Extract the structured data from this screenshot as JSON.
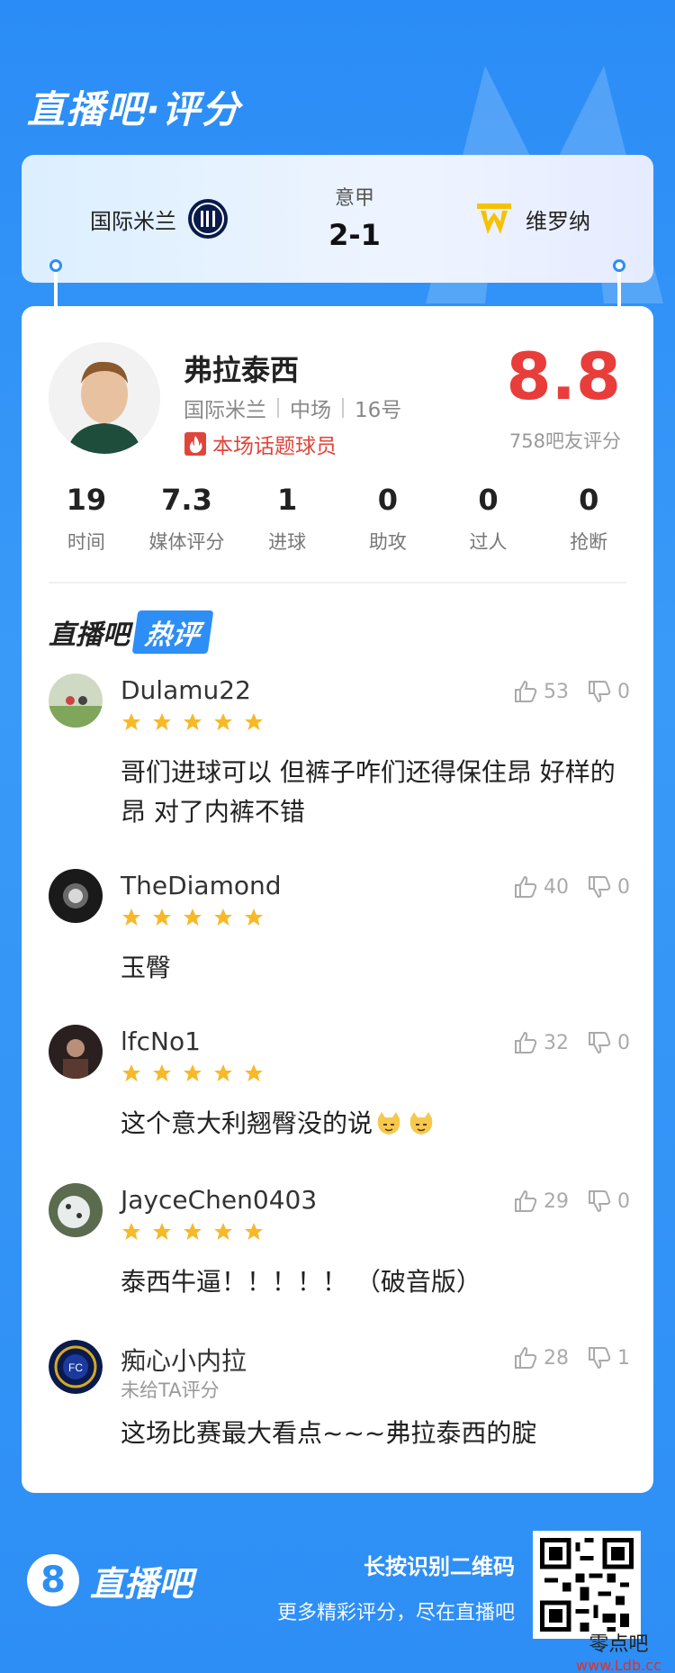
{
  "header": {
    "title": "直播吧·评分"
  },
  "match": {
    "home_team": "国际米兰",
    "away_team": "维罗纳",
    "league": "意甲",
    "score": "2-1"
  },
  "player": {
    "name": "弗拉泰西",
    "team": "国际米兰",
    "position": "中场",
    "number": "16号",
    "hot_tag": "本场话题球员",
    "rating": "8.8",
    "rating_count": "758吧友评分"
  },
  "stats": [
    {
      "value": "19",
      "label": "时间"
    },
    {
      "value": "7.3",
      "label": "媒体评分"
    },
    {
      "value": "1",
      "label": "进球"
    },
    {
      "value": "0",
      "label": "助攻"
    },
    {
      "value": "0",
      "label": "过人"
    },
    {
      "value": "0",
      "label": "抢断"
    }
  ],
  "hot_section": {
    "title_part1": "直播吧",
    "title_part2": "热评"
  },
  "comments": [
    {
      "user": "Dulamu22",
      "stars": 5,
      "likes": "53",
      "dislikes": "0",
      "text": "哥们进球可以 但裤子咋们还得保住昂 好样的昂 对了内裤不错"
    },
    {
      "user": "TheDiamond",
      "stars": 5,
      "likes": "40",
      "dislikes": "0",
      "text": "玉臀"
    },
    {
      "user": "lfcNo1",
      "stars": 5,
      "likes": "32",
      "dislikes": "0",
      "text": "这个意大利翘臀没的说"
    },
    {
      "user": "JayceChen0403",
      "stars": 5,
      "likes": "29",
      "dislikes": "0",
      "text": "泰西牛逼！！！！！ （破音版）"
    },
    {
      "user": "痴心小内拉",
      "stars": 0,
      "sub": "未给TA评分",
      "likes": "28",
      "dislikes": "1",
      "text": "这场比赛最大看点~~~弗拉泰西的腚"
    }
  ],
  "footer": {
    "logo_char": "8",
    "brand": "直播吧",
    "line1": "长按识别二维码",
    "line2": "更多精彩评分，尽在直播吧"
  },
  "watermark": {
    "line1": "零点吧",
    "line2": "www.Ldb.cc"
  },
  "colors": {
    "primary": "#2d8ef5",
    "rating": "#e83d3a",
    "star": "#f7b928"
  }
}
